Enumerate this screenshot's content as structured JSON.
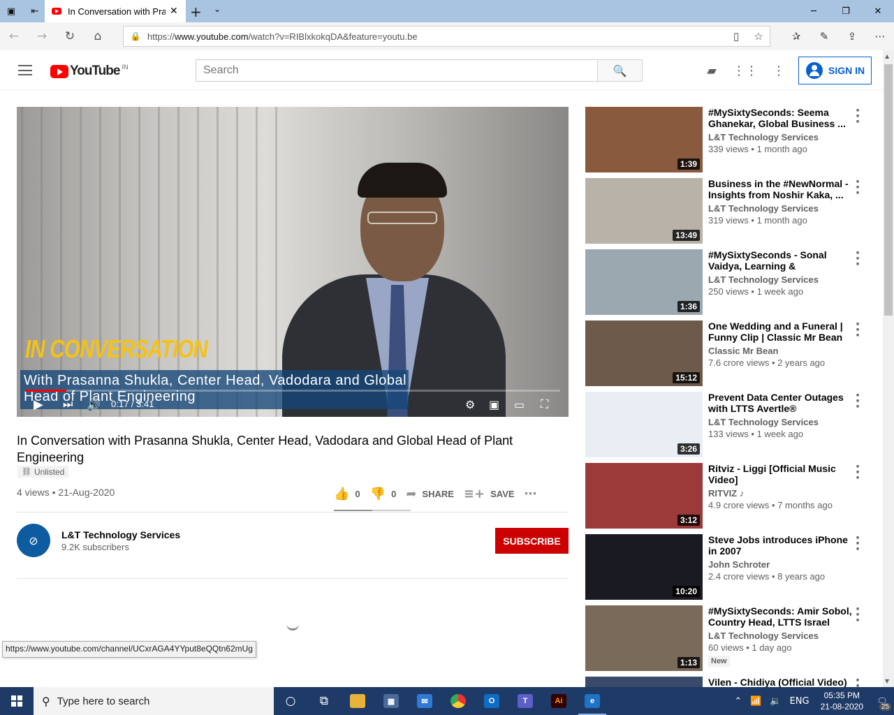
{
  "browser": {
    "tab_title": "In Conversation with Prasanna Shukla",
    "url_prefix": "https://",
    "url_host": "www.youtube.com",
    "url_path": "/watch?v=RIBlxkokqDA&feature=youtu.be"
  },
  "youtube": {
    "logo_text": "YouTube",
    "region": "IN",
    "search_placeholder": "Search",
    "sign_in_label": "SIGN IN"
  },
  "video": {
    "overlay_title": "IN CONVERSATION",
    "overlay_subtitle": "With Prasanna Shukla, Center Head, Vadodara and Global Head of Plant Engineering",
    "time": "0:17 / 3:41",
    "progress_fraction": 0.077,
    "title": "In Conversation with Prasanna Shukla, Center Head, Vadodara and Global Head of Plant Engineering",
    "visibility": "Unlisted",
    "views_date": "4 views • 21-Aug-2020",
    "likes": "0",
    "dislikes": "0",
    "share_label": "SHARE",
    "save_label": "SAVE"
  },
  "channel": {
    "name": "L&T Technology Services",
    "subscribers": "9.2K subscribers",
    "subscribe_label": "SUBSCRIBE"
  },
  "status_tooltip": "https://www.youtube.com/channel/UCxrAGA4YYput8eQQtn62mUg",
  "recommendations": [
    {
      "title": "#MySixtySeconds: Seema Ghanekar, Global Business ...",
      "channel": "L&T Technology Services",
      "meta": "339 views • 1 month ago",
      "duration": "1:39",
      "thumb": "#8a5a3e"
    },
    {
      "title": "Business in the #NewNormal - Insights from Noshir Kaka, ...",
      "channel": "L&T Technology Services",
      "meta": "319 views • 1 month ago",
      "duration": "13:49",
      "thumb": "#b8b2a8"
    },
    {
      "title": "#MySixtySeconds - Sonal Vaidya, Learning & Development",
      "channel": "L&T Technology Services",
      "meta": "250 views • 1 week ago",
      "duration": "1:36",
      "thumb": "#9aa8b0"
    },
    {
      "title": "One Wedding and a Funeral | Funny Clip | Classic Mr Bean",
      "channel": "Classic Mr Bean",
      "meta": "7.6 crore views • 2 years ago",
      "duration": "15:12",
      "thumb": "#6e5a4a"
    },
    {
      "title": "Prevent Data Center Outages with LTTS Avertle®",
      "channel": "L&T Technology Services",
      "meta": "133 views • 1 week ago",
      "duration": "3:26",
      "thumb": "#e8eef4"
    },
    {
      "title": "Ritviz - Liggi [Official Music Video]",
      "channel": "RITVIZ ♪",
      "meta": "4.9 crore views • 7 months ago",
      "duration": "3:12",
      "thumb": "#9c3a3a"
    },
    {
      "title": "Steve Jobs introduces iPhone in 2007",
      "channel": "John Schroter",
      "meta": "2.4 crore views • 8 years ago",
      "duration": "10:20",
      "thumb": "#1a1a22"
    },
    {
      "title": "#MySixtySeconds: Amir Sobol, Country Head, LTTS Israel",
      "channel": "L&T Technology Services",
      "meta": "60 views • 1 day ago",
      "duration": "1:13",
      "thumb": "#7a6a5a",
      "badge": "New"
    },
    {
      "title": "Vilen - Chidiya (Official Video)",
      "channel": "",
      "meta": "",
      "duration": "",
      "thumb": "#3a4a6a"
    }
  ],
  "taskbar": {
    "search_placeholder": "Type here to search",
    "language": "ENG",
    "time": "05:35 PM",
    "date": "21-08-2020",
    "notifications": "25"
  }
}
